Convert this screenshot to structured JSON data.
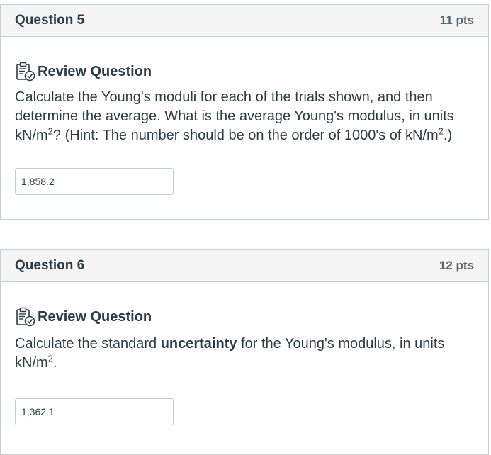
{
  "q5": {
    "title": "Question 5",
    "points": "11 pts",
    "review_label": "Review Question",
    "text_part1": "Calculate the Young's moduli for each of the trials shown, and then determine the average. What is the average Young's modulus, in units kN/m",
    "sup1": "2",
    "text_part2": "? (Hint: The number should be on the order of 1000's of kN/m",
    "sup2": "2",
    "text_part3": ".)",
    "answer_value": "1,858.2"
  },
  "q6": {
    "title": "Question 6",
    "points": "12 pts",
    "review_label": "Review Question",
    "text_part1": "Calculate the standard ",
    "text_bold": "uncertainty",
    "text_part2": " for the Young's modulus, in units kN/m",
    "sup1": "2",
    "text_part3": ".",
    "answer_value": "1,362.1"
  },
  "icons": {
    "review": "clipboard-check-icon"
  }
}
